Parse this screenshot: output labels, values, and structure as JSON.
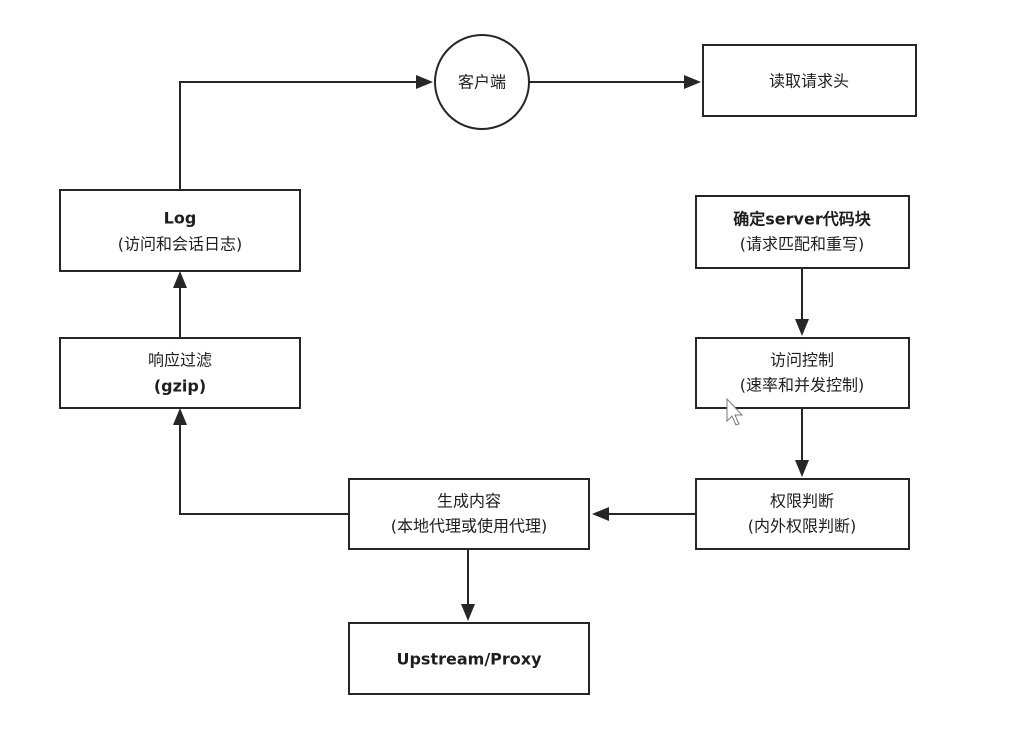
{
  "colors": {
    "stroke": "#262626",
    "text": "#1e1e1e",
    "background": "#ffffff"
  },
  "nodes": {
    "client": {
      "label": "客户端"
    },
    "read_headers": {
      "label": "读取请求头"
    },
    "server_block": {
      "line1": "确定server代码块",
      "line2": "(请求匹配和重写)"
    },
    "access_control": {
      "line1": "访问控制",
      "line2": "(速率和并发控制)"
    },
    "permission": {
      "line1": "权限判断",
      "line2": "(内外权限判断)"
    },
    "generate_content": {
      "line1": "生成内容",
      "line2": "(本地代理或使用代理)"
    },
    "upstream": {
      "label": "Upstream/Proxy"
    },
    "response_filter": {
      "line1": "响应过滤",
      "line2": "(gzip)"
    },
    "log": {
      "line1": "Log",
      "line2": "(访问和会话日志)"
    }
  },
  "icons": {
    "cursor": "mouse-pointer-icon"
  }
}
